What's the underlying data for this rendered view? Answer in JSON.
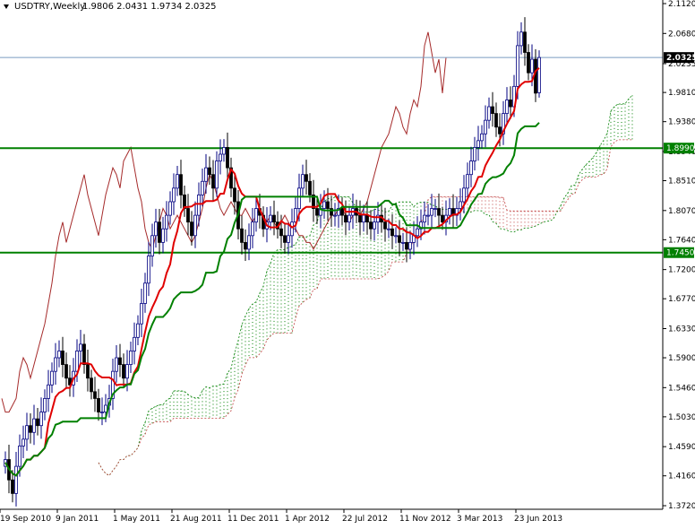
{
  "header": {
    "symbol_label": "USDTRY,Weekly",
    "ohlc_label": "1.9806 2.0431 1.9734 2.0325",
    "dropdown_icon": "triangle-down-icon"
  },
  "colors": {
    "background": "#ffffff",
    "bull_candle": "#000080",
    "bear_candle": "#000000",
    "tenkan": "#e00000",
    "kijun": "#008000",
    "chikou": "#a52a2a",
    "cloud_bull": "#008000",
    "cloud_bear": "#c04040",
    "level_line": "#008000",
    "price_line": "#7a9cc0"
  },
  "chart_data": {
    "type": "candlestick-ichimoku",
    "title": "USDTRY,Weekly",
    "ohlc": {
      "open": 1.9806,
      "high": 2.0431,
      "low": 1.9734,
      "close": 2.0325
    },
    "ylim": [
      1.372,
      2.112
    ],
    "x_start": "2010-09-19",
    "x_end": "2013-10-06",
    "x_ticks": [
      "19 Sep 2010",
      "9 Jan 2011",
      "1 May 2011",
      "21 Aug 2011",
      "11 Dec 2011",
      "1 Apr 2012",
      "22 Jul 2012",
      "11 Nov 2012",
      "3 Mar 2013",
      "23 Jun 2013"
    ],
    "y_ticks": [
      "2.1120",
      "2.0680",
      "2.0235",
      "1.9810",
      "1.9380",
      "1.8940",
      "1.8510",
      "1.8070",
      "1.7640",
      "1.7200",
      "1.6770",
      "1.6330",
      "1.5900",
      "1.5460",
      "1.5030",
      "1.4590",
      "1.4160",
      "1.3720"
    ],
    "horizontal_levels": [
      {
        "value": 1.899,
        "label": "1.8990"
      },
      {
        "value": 1.745,
        "label": "1.7450"
      }
    ],
    "current_price": {
      "value": 2.0325,
      "label": "2.0325"
    },
    "weekly_close": [
      1.44,
      1.41,
      1.39,
      1.43,
      1.46,
      1.47,
      1.49,
      1.48,
      1.5,
      1.49,
      1.51,
      1.53,
      1.55,
      1.57,
      1.59,
      1.6,
      1.58,
      1.56,
      1.55,
      1.57,
      1.6,
      1.61,
      1.58,
      1.56,
      1.54,
      1.53,
      1.51,
      1.51,
      1.52,
      1.53,
      1.57,
      1.59,
      1.58,
      1.56,
      1.58,
      1.6,
      1.62,
      1.64,
      1.67,
      1.7,
      1.74,
      1.77,
      1.79,
      1.76,
      1.78,
      1.8,
      1.82,
      1.84,
      1.86,
      1.83,
      1.81,
      1.79,
      1.77,
      1.8,
      1.83,
      1.85,
      1.87,
      1.86,
      1.84,
      1.88,
      1.89,
      1.9,
      1.87,
      1.84,
      1.82,
      1.78,
      1.76,
      1.75,
      1.77,
      1.79,
      1.81,
      1.8,
      1.78,
      1.79,
      1.8,
      1.79,
      1.78,
      1.77,
      1.76,
      1.77,
      1.79,
      1.81,
      1.84,
      1.86,
      1.85,
      1.83,
      1.81,
      1.8,
      1.81,
      1.82,
      1.81,
      1.8,
      1.8,
      1.81,
      1.8,
      1.79,
      1.8,
      1.81,
      1.8,
      1.79,
      1.8,
      1.79,
      1.78,
      1.79,
      1.8,
      1.79,
      1.78,
      1.78,
      1.77,
      1.77,
      1.76,
      1.76,
      1.75,
      1.76,
      1.77,
      1.78,
      1.79,
      1.8,
      1.8,
      1.81,
      1.81,
      1.8,
      1.79,
      1.8,
      1.81,
      1.8,
      1.81,
      1.82,
      1.84,
      1.86,
      1.88,
      1.9,
      1.91,
      1.92,
      1.94,
      1.96,
      1.95,
      1.93,
      1.92,
      1.95,
      1.97,
      1.96,
      1.99,
      2.05,
      2.07,
      2.04,
      2.01,
      2.03,
      1.98,
      2.0325
    ],
    "chikou_x_offset_weeks": -26,
    "tenkan_period": 9,
    "kijun_period": 26,
    "senkou_b_period": 52,
    "cloud_shift_weeks": 26
  }
}
